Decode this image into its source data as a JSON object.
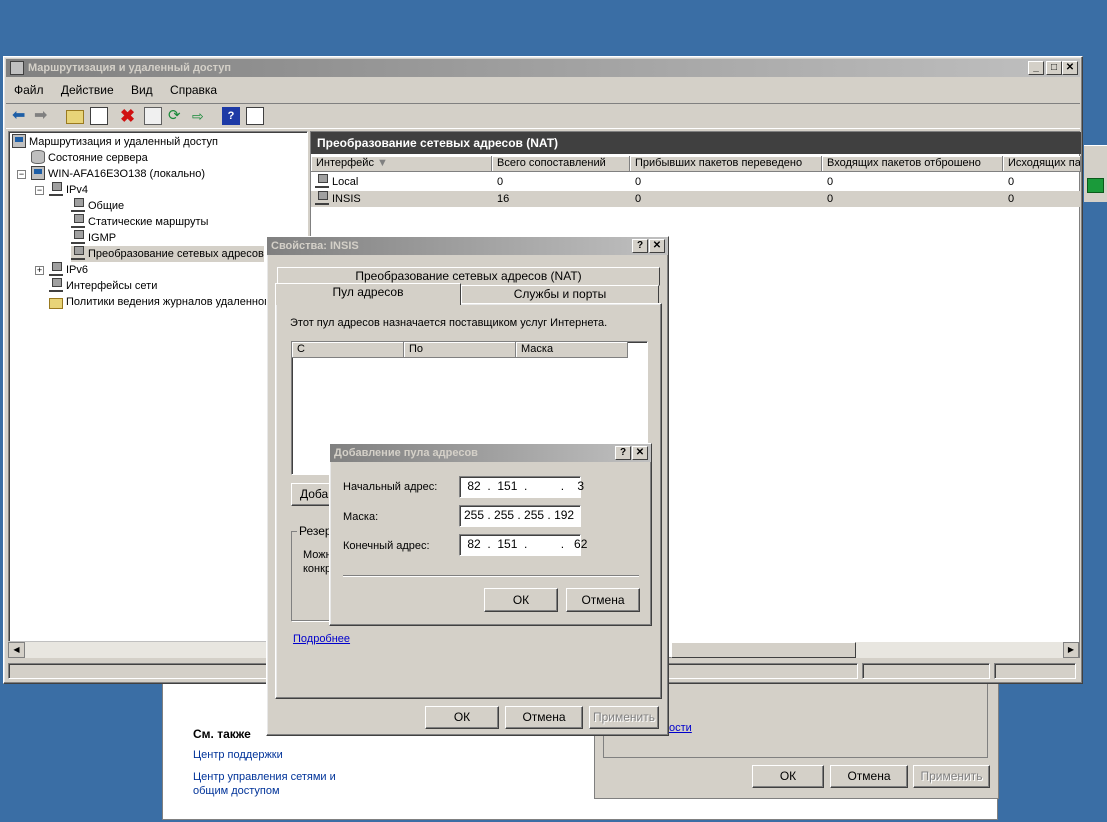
{
  "main_window": {
    "title": "Маршрутизация и удаленный доступ",
    "menu": [
      "Файл",
      "Действие",
      "Вид",
      "Справка"
    ],
    "tree": {
      "root": "Маршрутизация и удаленный доступ",
      "server_status": "Состояние сервера",
      "server": "WIN-AFA16E3O138 (локально)",
      "ipv4": "IPv4",
      "general": "Общие",
      "static_routes": "Статические маршруты",
      "igmp": "IGMP",
      "nat": "Преобразование сетевых адресов",
      "ipv6": "IPv6",
      "interfaces": "Интерфейсы сети",
      "logging": "Политики ведения журналов удаленного"
    },
    "right_pane": {
      "title": "Преобразование сетевых адресов (NAT)",
      "columns": [
        "Интерфейс",
        "Всего сопоставлений",
        "Прибывших пакетов переведено",
        "Входящих пакетов отброшено",
        "Исходящих па"
      ],
      "rows": [
        [
          "Local",
          "0",
          "0",
          "0",
          "0"
        ],
        [
          "INSIS",
          "16",
          "0",
          "0",
          "0"
        ]
      ]
    }
  },
  "bg_window": {
    "see_also": "См. также",
    "link1": "Центр поддержки",
    "link2": "Центр управления сетями и общим доступом",
    "link_partial": "ости",
    "ok": "ОК",
    "cancel": "Отмена",
    "apply": "Применить"
  },
  "props_dialog": {
    "title": "Свойства: INSIS",
    "tab_nat": "Преобразование сетевых адресов (NAT)",
    "tab_pool": "Пул адресов",
    "tab_services": "Службы и порты",
    "description": "Этот пул адресов назначается поставщиком услуг Интернета.",
    "columns": [
      "С",
      "По",
      "Маска"
    ],
    "add_button_partial": "Добав",
    "reserve_partial": "Резер",
    "can_partial": "Можн",
    "konk_partial": "конкр",
    "more_link": "Подробнее",
    "ok": "ОК",
    "cancel": "Отмена",
    "apply": "Применить"
  },
  "add_pool_dialog": {
    "title": "Добавление пула адресов",
    "start_label": "Начальный адрес:",
    "start_value": " 82  .  151  .          .    3",
    "mask_label": "Маска:",
    "mask_value": "255 . 255 . 255 . 192",
    "end_label": "Конечный адрес:",
    "end_value": " 82  .  151  .          .   62",
    "ok": "ОК",
    "cancel": "Отмена"
  }
}
